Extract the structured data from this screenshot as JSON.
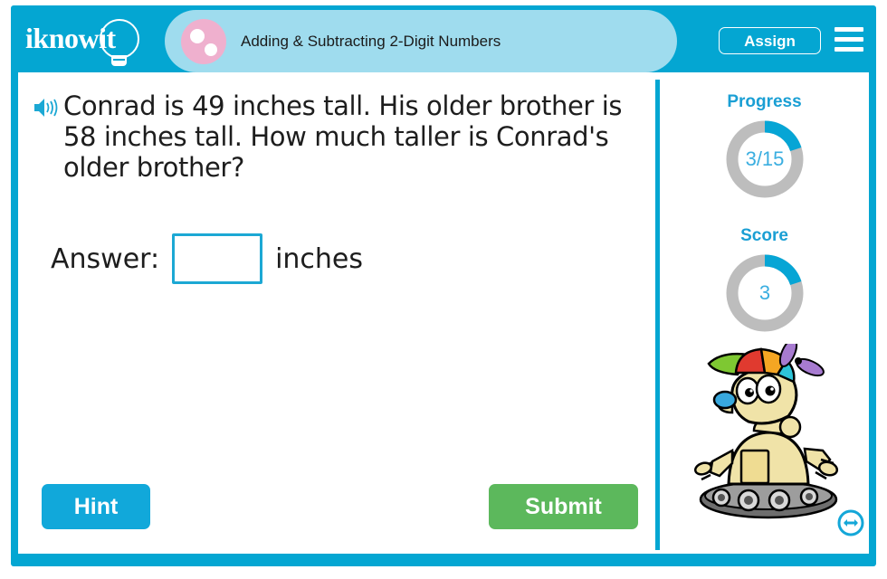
{
  "brand": {
    "logo_text": "iknowit",
    "logo_icon": "lightbulb-icon",
    "primary_color": "#04a6d2",
    "banner_color": "#9fdcee",
    "accent_pink": "#efb0ce",
    "submit_color": "#5cb85c"
  },
  "header": {
    "title": "Adding & Subtracting 2-Digit Numbers",
    "assign_label": "Assign",
    "menu_icon": "hamburger-menu-icon",
    "decor_icon": "pink-dots-circle-icon"
  },
  "question": {
    "speaker_icon": "speaker-audio-icon",
    "text": "Conrad is 49 inches tall. His older brother is 58 inches tall. How much taller is Conrad's older brother?"
  },
  "answer": {
    "label": "Answer:",
    "value": "",
    "placeholder": "",
    "unit": "inches"
  },
  "actions": {
    "hint_label": "Hint",
    "submit_label": "Submit"
  },
  "sidebar": {
    "progress": {
      "title": "Progress",
      "value_text": "3/15",
      "current": 3,
      "total": 15,
      "percent": 20,
      "arc_color": "#06a5d5",
      "track_color": "#bdbdbd"
    },
    "score": {
      "title": "Score",
      "value_text": "3",
      "percent": 20,
      "arc_color": "#06a5d5",
      "track_color": "#bdbdbd"
    },
    "mascot_icon": "robot-mascot-propeller-hat",
    "resize_icon": "horizontal-resize-arrow-icon"
  }
}
